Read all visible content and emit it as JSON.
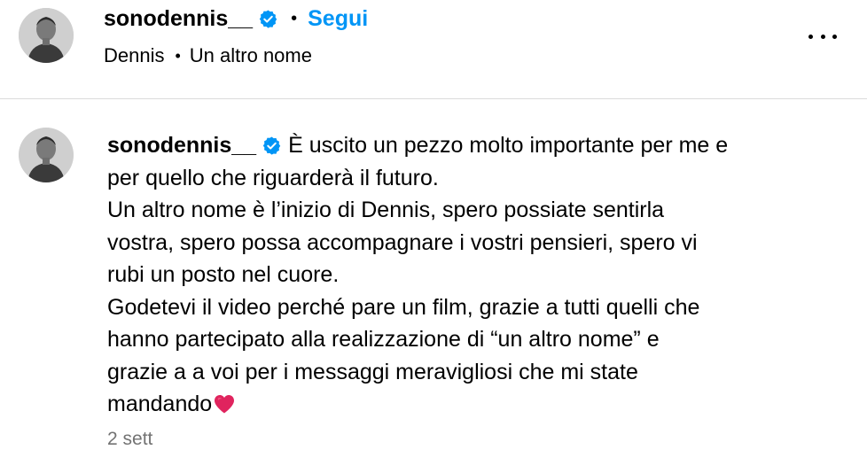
{
  "header": {
    "username": "sonodennis__",
    "separator": "•",
    "follow_label": "Segui",
    "subtitle_artist": "Dennis",
    "subtitle_track": "Un altro nome",
    "more_icon": "more-horizontal-icon",
    "verified_icon": "verified-badge-icon"
  },
  "caption": {
    "username": "sonodennis__",
    "lines": [
      "È uscito un pezzo molto importante per me e",
      "per quello che riguarderà il futuro.",
      "Un altro nome è l’inizio di Dennis, spero possiate sentirla",
      "vostra, spero possa accompagnare i vostri pensieri, spero vi",
      "rubi un posto nel cuore.",
      "Godetevi il video perché pare un film, grazie a tutti quelli che",
      "hanno partecipato alla realizzazione di “un altro nome” e",
      "grazie a a voi per i messaggi meravigliosi che mi state",
      "mandando"
    ],
    "heart_icon": "red-heart-icon",
    "timestamp": "2 sett"
  },
  "colors": {
    "accent": "#0095f6",
    "verified": "#0095f6",
    "secondary_text": "#737373",
    "divider": "#dbdbdb",
    "heart": "#e0245e"
  }
}
